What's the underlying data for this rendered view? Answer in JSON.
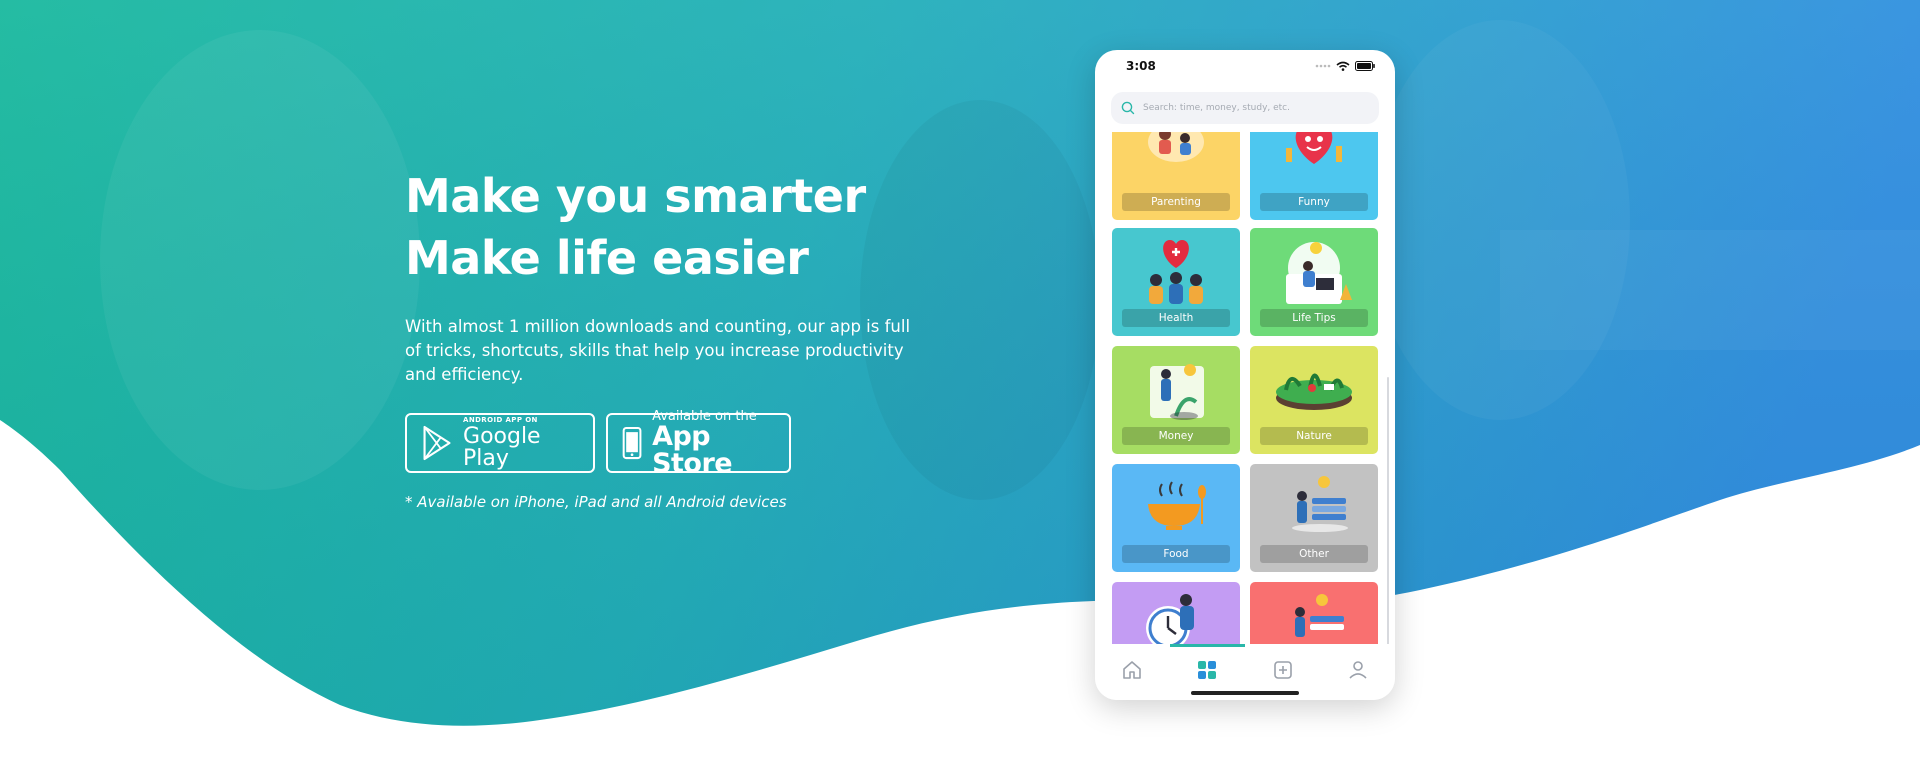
{
  "hero": {
    "headline_line1": "Make you smarter",
    "headline_line2": "Make life easier",
    "subtext": "With almost 1 million downloads and counting, our app is full of tricks, shortcuts, skills that help you increase productivity and efficiency.",
    "google_play": {
      "small": "ANDROID APP ON",
      "big": "Google Play"
    },
    "app_store": {
      "small": "Available on the",
      "big": "App Store"
    },
    "note": "* Available on iPhone, iPad and all Android devices"
  },
  "colors": {
    "gradient_start": "#16b79f",
    "gradient_end": "#2d8fdb",
    "accent": "#2ab7a9"
  },
  "phone": {
    "status_time": "3:08",
    "search_placeholder": "Search: time, money, study, etc.",
    "categories": [
      {
        "label": "Parenting",
        "color": "#fcd466"
      },
      {
        "label": "Funny",
        "color": "#4dc7ef"
      },
      {
        "label": "Health",
        "color": "#47c7cf"
      },
      {
        "label": "Life Tips",
        "color": "#6edb79"
      },
      {
        "label": "Money",
        "color": "#a6dd63"
      },
      {
        "label": "Nature",
        "color": "#dce461"
      },
      {
        "label": "Food",
        "color": "#5ab8f5"
      },
      {
        "label": "Other",
        "color": "#c2c2c2"
      },
      {
        "label": "",
        "color": "#c39cf3"
      },
      {
        "label": "",
        "color": "#f97070"
      }
    ],
    "tabs": [
      "home-icon",
      "grid-icon",
      "add-icon",
      "profile-icon"
    ],
    "active_tab": "grid-icon"
  }
}
